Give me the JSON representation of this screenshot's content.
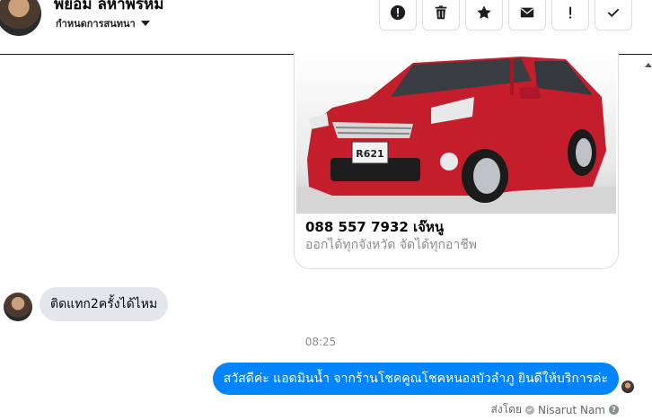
{
  "header": {
    "contact_name": "พีย้อม ลีหาพรหม",
    "contact_subtitle": "กำหนดการสนทนา",
    "toolbar": [
      {
        "icon": "alert-circle-icon"
      },
      {
        "icon": "trash-icon"
      },
      {
        "icon": "star-icon"
      },
      {
        "icon": "envelope-icon"
      },
      {
        "icon": "exclamation-icon"
      },
      {
        "icon": "checkmark-icon"
      }
    ]
  },
  "card": {
    "title": "088 557 7932 เจ๊หนู",
    "subtitle": "ออกได้ทุกจังหวัด จัดได้ทุกอาชีพ",
    "plate": "R621"
  },
  "messages": {
    "incoming_text": "ติดแทก2ครั้งได้ไหม",
    "timestamp": "08:25",
    "outgoing_text": "สวัสดีค่ะ แอดมินน้ำ จากร้านโชคคูณโชคหนองบัวลำภู ยินดีให้บริการค่ะ",
    "sent_by_label": "ส่งโดย",
    "sent_by_name": "Nisarut Nam"
  },
  "colors": {
    "accent": "#0084ff",
    "bubble_in": "#e4e6eb"
  }
}
